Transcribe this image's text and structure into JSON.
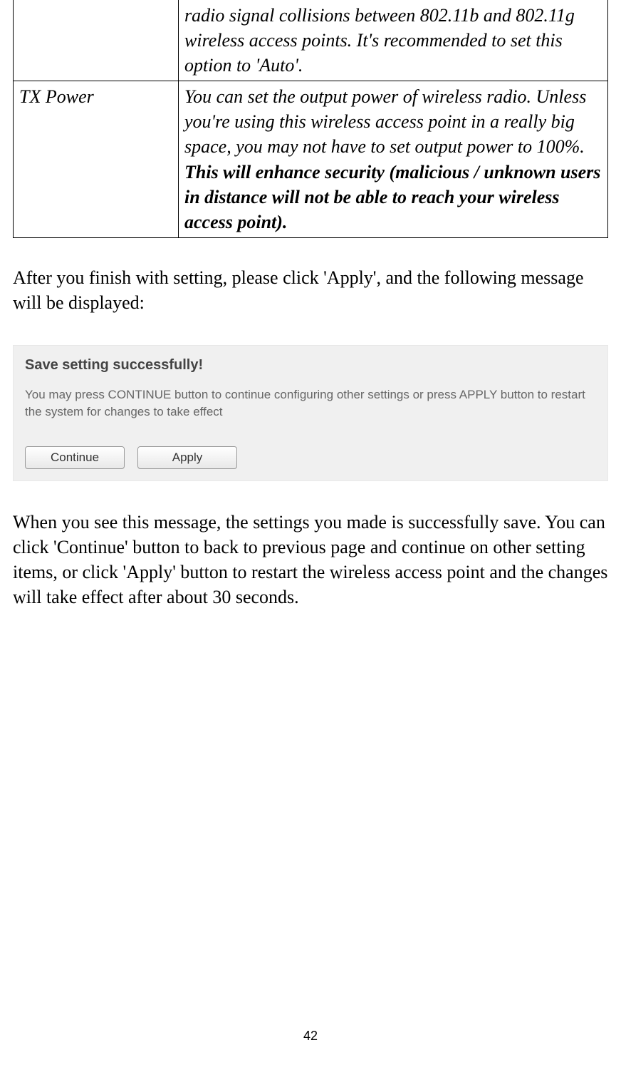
{
  "table": {
    "row1": {
      "label": "",
      "desc": "radio signal collisions between 802.11b and 802.11g wireless access points. It's recommended to set this option to 'Auto'."
    },
    "row2": {
      "label": "TX Power",
      "desc_plain": "You can set the output power of wireless radio. Unless you're using this wireless access point in a really big space, you may not have to set output power to 100%. ",
      "desc_bold": "This will enhance security (malicious / unknown users in distance will not be able to reach your wireless access point)."
    }
  },
  "para1": "After you finish with setting, please click 'Apply', and the following message will be displayed:",
  "dialog": {
    "title": "Save setting successfully!",
    "text": "You may press CONTINUE button to continue configuring other settings or press APPLY button to restart the system for changes to take effect",
    "continue_label": "Continue",
    "apply_label": "Apply"
  },
  "para2": "When you see this message, the settings you made is successfully save. You can click 'Continue' button to back to previous page and continue on other setting items, or click 'Apply' button to restart the wireless access point and the changes will take effect after about 30 seconds.",
  "page_number": "42"
}
